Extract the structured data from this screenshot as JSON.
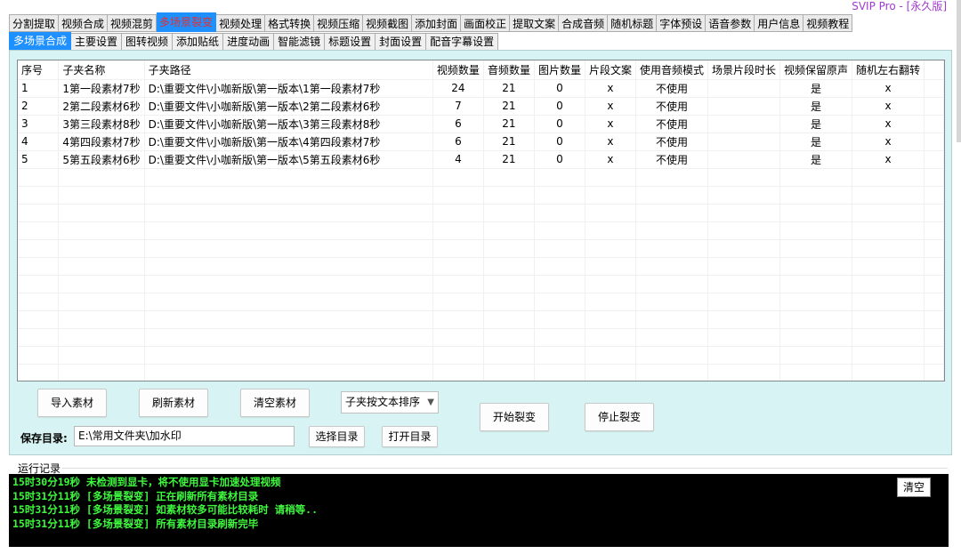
{
  "window": {
    "title": "SVIP Pro - [永久版]"
  },
  "main_tabs": [
    {
      "label": "分割提取",
      "active": false
    },
    {
      "label": "视频合成",
      "active": false
    },
    {
      "label": "视频混剪",
      "active": false
    },
    {
      "label": "多场景裂变",
      "active": true
    },
    {
      "label": "视频处理",
      "active": false
    },
    {
      "label": "格式转换",
      "active": false
    },
    {
      "label": "视频压缩",
      "active": false
    },
    {
      "label": "视频截图",
      "active": false
    },
    {
      "label": "添加封面",
      "active": false
    },
    {
      "label": "画面校正",
      "active": false
    },
    {
      "label": "提取文案",
      "active": false
    },
    {
      "label": "合成音频",
      "active": false
    },
    {
      "label": "随机标题",
      "active": false
    },
    {
      "label": "字体预设",
      "active": false
    },
    {
      "label": "语音参数",
      "active": false
    },
    {
      "label": "用户信息",
      "active": false
    },
    {
      "label": "视频教程",
      "active": false
    }
  ],
  "sub_tabs": [
    {
      "label": "多场景合成",
      "active": true
    },
    {
      "label": "主要设置",
      "active": false
    },
    {
      "label": "图转视频",
      "active": false
    },
    {
      "label": "添加贴纸",
      "active": false
    },
    {
      "label": "进度动画",
      "active": false
    },
    {
      "label": "智能滤镜",
      "active": false
    },
    {
      "label": "标题设置",
      "active": false
    },
    {
      "label": "封面设置",
      "active": false
    },
    {
      "label": "配音字幕设置",
      "active": false
    }
  ],
  "table": {
    "columns": [
      "序号",
      "子夹名称",
      "子夹路径",
      "视频数量",
      "音频数量",
      "图片数量",
      "片段文案",
      "使用音频模式",
      "场景片段时长",
      "视频保留原声",
      "随机左右翻转"
    ],
    "rows": [
      [
        "1",
        "1第一段素材7秒",
        "D:\\重要文件\\小咖新版\\第一版本\\1第一段素材7秒",
        "24",
        "21",
        "0",
        "x",
        "不使用",
        "",
        "是",
        "x"
      ],
      [
        "2",
        "2第二段素材6秒",
        "D:\\重要文件\\小咖新版\\第一版本\\2第二段素材6秒",
        "7",
        "21",
        "0",
        "x",
        "不使用",
        "",
        "是",
        "x"
      ],
      [
        "3",
        "3第三段素材8秒",
        "D:\\重要文件\\小咖新版\\第一版本\\3第三段素材8秒",
        "6",
        "21",
        "0",
        "x",
        "不使用",
        "",
        "是",
        "x"
      ],
      [
        "4",
        "4第四段素材7秒",
        "D:\\重要文件\\小咖新版\\第一版本\\4第四段素材7秒",
        "6",
        "21",
        "0",
        "x",
        "不使用",
        "",
        "是",
        "x"
      ],
      [
        "5",
        "5第五段素材6秒",
        "D:\\重要文件\\小咖新版\\第一版本\\5第五段素材6秒",
        "4",
        "21",
        "0",
        "x",
        "不使用",
        "",
        "是",
        "x"
      ]
    ]
  },
  "controls": {
    "import_label": "导入素材",
    "refresh_label": "刷新素材",
    "clear_material_label": "清空素材",
    "sort_select_value": "子夹按文本排序",
    "start_label": "开始裂变",
    "stop_label": "停止裂变",
    "save_dir_label": "保存目录:",
    "save_dir_value": "E:\\常用文件夹\\加水印",
    "choose_dir_label": "选择目录",
    "open_dir_label": "打开目录"
  },
  "log": {
    "label": "运行记录",
    "clear_label": "清空",
    "lines": [
      "15时30分19秒 未检测到显卡，将不使用显卡加速处理视频",
      "15时31分11秒 [多场景裂变] 正在刷新所有素材目录",
      "15时31分11秒 [多场景裂变] 如素材较多可能比较耗时 请稍等..",
      "15时31分11秒 [多场景裂变] 所有素材目录刷新完毕"
    ]
  },
  "colors": {
    "panel_bg": "#d7f3f3",
    "active_tab_bg": "#1e90ff",
    "active_main_tab_text": "#e03131",
    "title_text": "#a13ad1",
    "log_text": "#3ef83e",
    "log_bg": "#000000"
  }
}
